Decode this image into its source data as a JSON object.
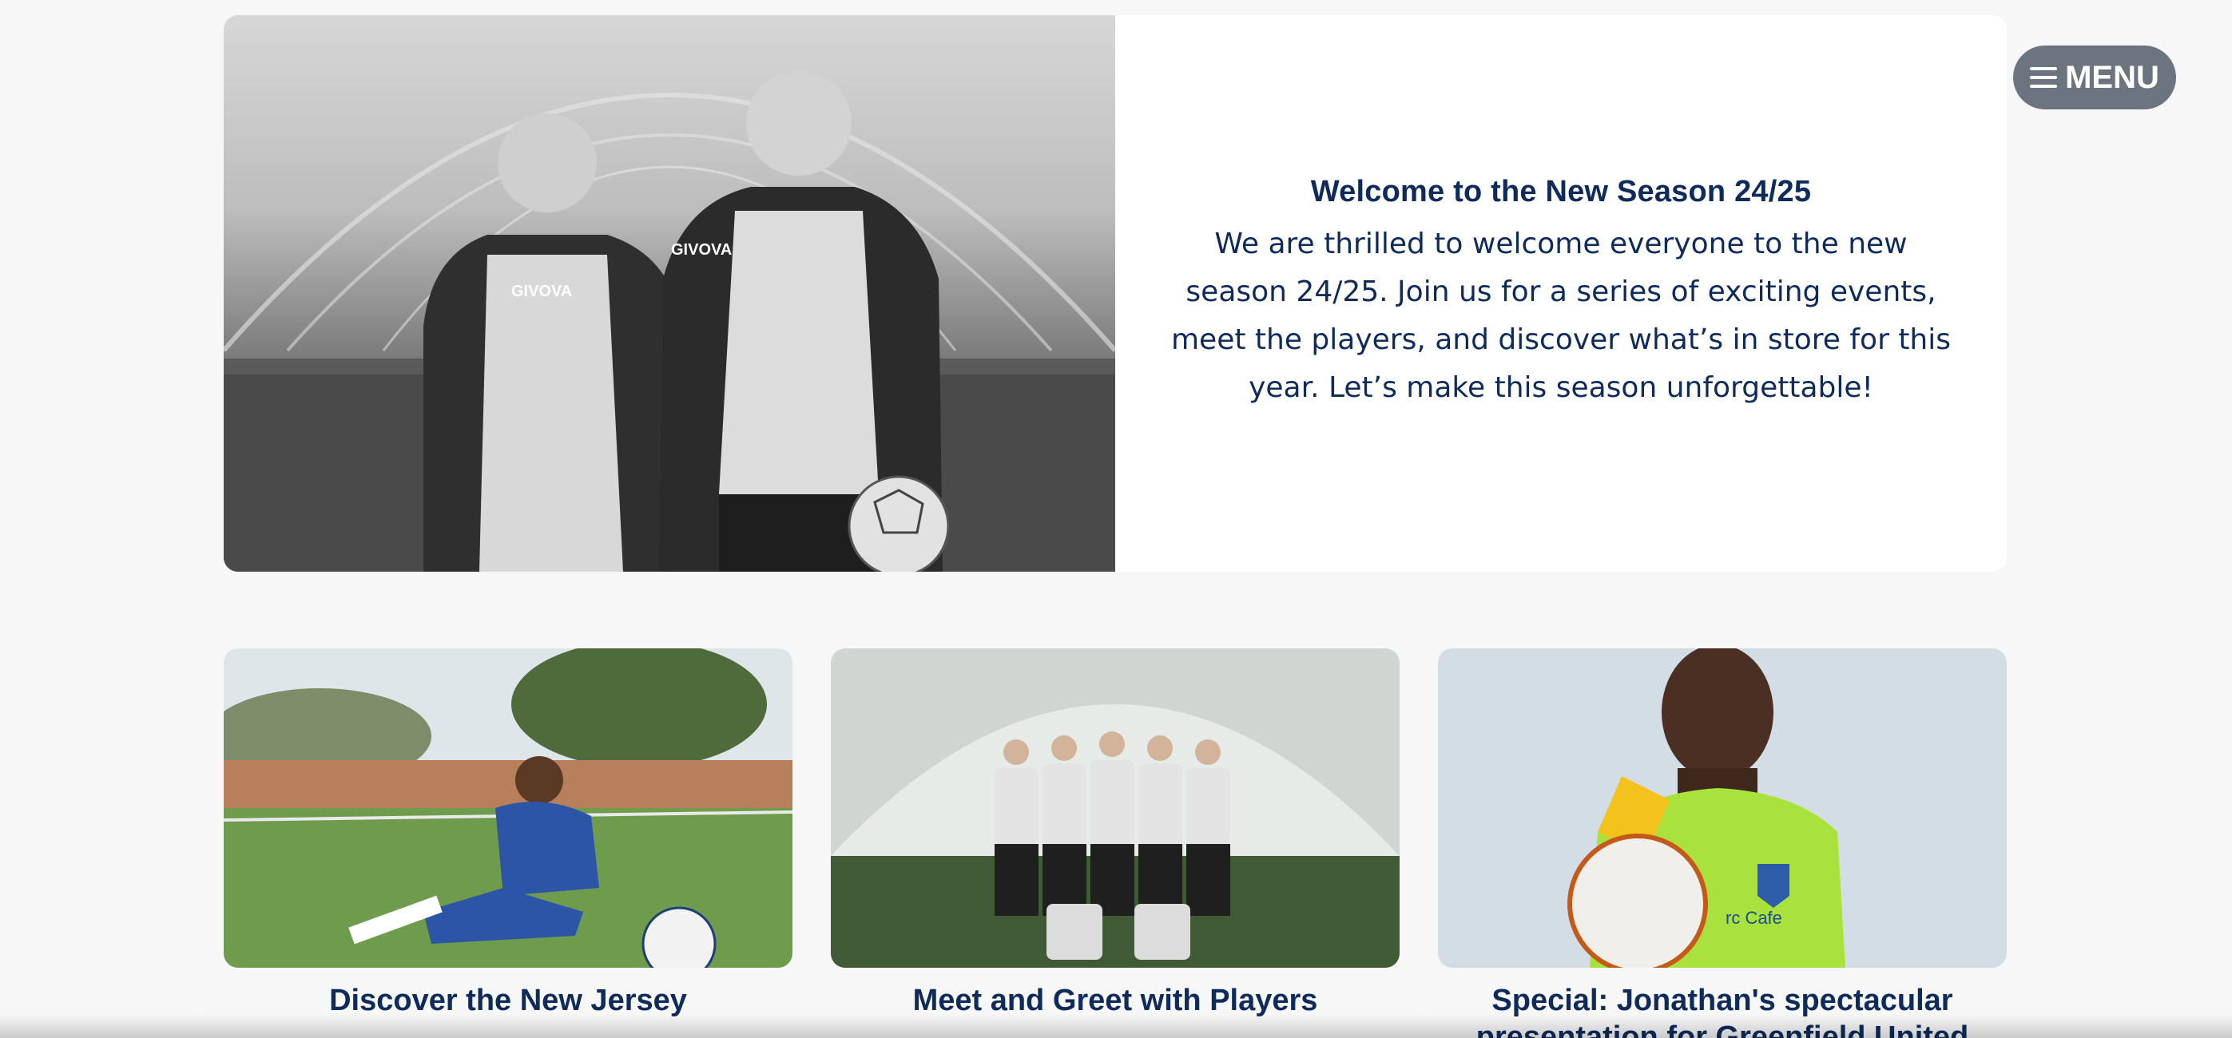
{
  "hero": {
    "title": "Welcome to the New Season 24/25",
    "body": "We are thrilled to welcome everyone to the new season 24/25. Join us for a series of exciting events, meet the players, and discover what’s in store for this year. Let’s make this season unforgettable!",
    "image_icon": "photo-two-players-black-and-white"
  },
  "menu": {
    "label": "MENU",
    "icon": "hamburger-icon"
  },
  "cards": [
    {
      "title": "Discover the New Jersey",
      "image_icon": "photo-player-sitting-with-ball"
    },
    {
      "title": "Meet and Greet with Players",
      "image_icon": "photo-team-group"
    },
    {
      "title": "Special: Jonathan's spectacular presentation for Greenfield United",
      "image_icon": "photo-goalkeeper-with-ball"
    }
  ],
  "colors": {
    "text": "#0e2b5c",
    "menu_bg": "#6c7480",
    "page_bg": "#f7f7f7"
  }
}
